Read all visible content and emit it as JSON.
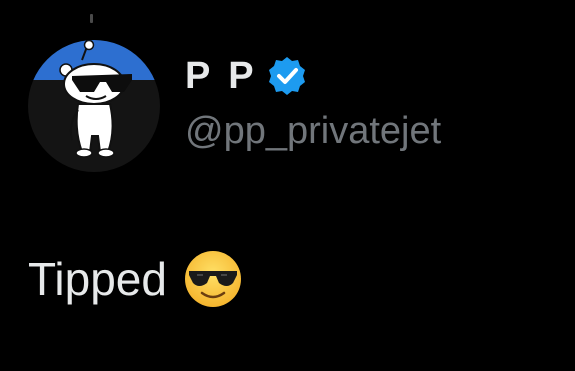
{
  "author": {
    "display_name": "P P",
    "handle": "@pp_privatejet",
    "verified": true,
    "avatar": "reddit-snoo-sunglasses-avatar",
    "avatar_colors": {
      "top": "#2d6fd0",
      "bottom": "#141414",
      "body": "#ffffff"
    }
  },
  "tweet": {
    "text": "Tipped",
    "emoji": "smiling-face-with-sunglasses"
  },
  "colors": {
    "background": "#000000",
    "name": "#e7e9ea",
    "handle": "#71767b",
    "verified_badge": "#1d9bf0",
    "emoji_face": "#ffcc33"
  }
}
